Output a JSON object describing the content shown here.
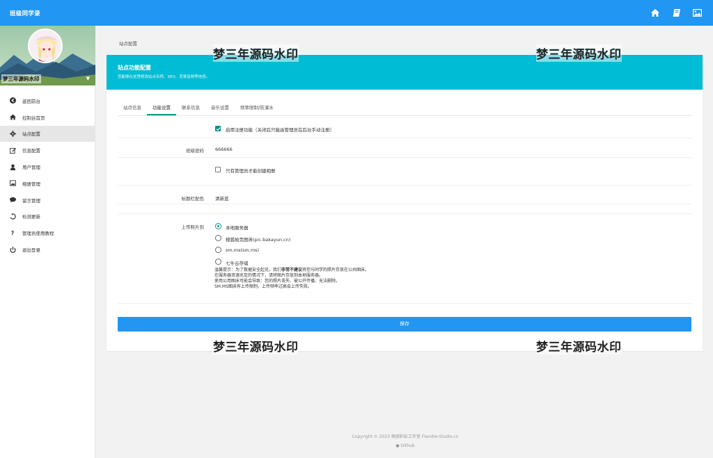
{
  "topbar": {
    "title": "班级同学录",
    "icons": [
      "home-icon",
      "book-icon",
      "image-icon"
    ]
  },
  "sidebar": {
    "username": "梦三年源码水印",
    "items": [
      {
        "label": "返回前台",
        "icon": "arrow-left-circle-icon"
      },
      {
        "label": "控制台首页",
        "icon": "home-icon"
      },
      {
        "label": "站点配置",
        "icon": "gear-icon",
        "active": true
      },
      {
        "label": "信息配置",
        "icon": "edit-icon"
      },
      {
        "label": "用户管理",
        "icon": "user-icon"
      },
      {
        "label": "相册管理",
        "icon": "image-icon"
      },
      {
        "label": "留言管理",
        "icon": "comment-icon"
      },
      {
        "label": "检测更新",
        "icon": "refresh-icon"
      },
      {
        "label": "管理员使用教程",
        "icon": "question-icon"
      },
      {
        "label": "退出登录",
        "icon": "power-icon"
      }
    ]
  },
  "breadcrumb": "站点配置",
  "card": {
    "title": "站点功能配置",
    "subtitle": "您能够在这里修改站点名称、SEO、背景音频等信息。",
    "tabs": [
      "站点信息",
      "功能设置",
      "联系信息",
      "音乐设置",
      "频率限制/防灌水"
    ],
    "active_tab": 1
  },
  "form": {
    "register": {
      "label": "启用注册功能（关闭后只能由管理员在后台手动注册）",
      "checked": true
    },
    "class_password": {
      "label": "班级密码",
      "value": "666666"
    },
    "admin_album": {
      "label": "只有管理员才能创建相册",
      "checked": false
    },
    "title_color": {
      "label": "标题栏配色",
      "value": "清新蓝"
    },
    "upload": {
      "label": "上传照片到",
      "options": [
        "本地服务器",
        "搜狐帕克图床(pic.bakayun.cn)",
        "sm.ms(sm.ms)",
        "七牛云存储"
      ],
      "selected": 0
    },
    "hint": {
      "line1_prefix": "温馨提示：为了数据安全起见，我们",
      "line1_bold": "非常不建议",
      "line1_suffix": "将您与同学的照片存放在公共图床。",
      "line2": "在服务器资源充足的情况下，请将图片存放到本地服务器。",
      "line3": "使用公用图床可能会导致：您的照片丢失、被公开传播、无法删除。",
      "line4": "SM.MS图床有上传限制，上传频率过高会上传失败。"
    },
    "save_label": "保存"
  },
  "watermark": "梦三年源码水印",
  "footer": {
    "copyright": "Copyright © 2023 梅丽彩虹工作室 Flandre-Studio.cn",
    "github": "Github"
  }
}
